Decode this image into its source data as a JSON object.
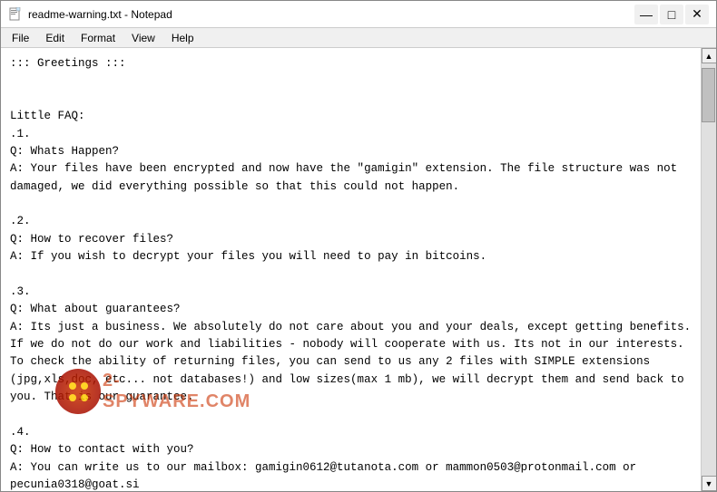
{
  "window": {
    "title": "readme-warning.txt - Notepad",
    "icon": "📄"
  },
  "controls": {
    "minimize": "—",
    "maximize": "□",
    "close": "✕"
  },
  "menu": {
    "items": [
      "File",
      "Edit",
      "Format",
      "View",
      "Help"
    ]
  },
  "content": {
    "text": "::: Greetings :::\n\n\nLittle FAQ:\n.1.\nQ: Whats Happen?\nA: Your files have been encrypted and now have the \"gamigin\" extension. The file structure was not\ndamaged, we did everything possible so that this could not happen.\n\n.2.\nQ: How to recover files?\nA: If you wish to decrypt your files you will need to pay in bitcoins.\n\n.3.\nQ: What about guarantees?\nA: Its just a business. We absolutely do not care about you and your deals, except getting benefits.\nIf we do not do our work and liabilities - nobody will cooperate with us. Its not in our interests.\nTo check the ability of returning files, you can send to us any 2 files with SIMPLE extensions\n(jpg,xls,doc, etc... not databases!) and low sizes(max 1 mb), we will decrypt them and send back to\nyou. That is our guarantee.\n\n.4.\nQ: How to contact with you?\nA: You can write us to our mailbox: gamigin0612@tutanota.com or mammon0503@protonmail.com or\npecunia0318@goat.si\n\n\nQ: Will the decryption process proceed after payment?\nA: After payment we will send to you our scanner-decoder program and detailed instructions for use.\nWith this program you will be able to decrypt all your encrypted files."
  },
  "watermark": {
    "text": "2-spyware.com"
  }
}
